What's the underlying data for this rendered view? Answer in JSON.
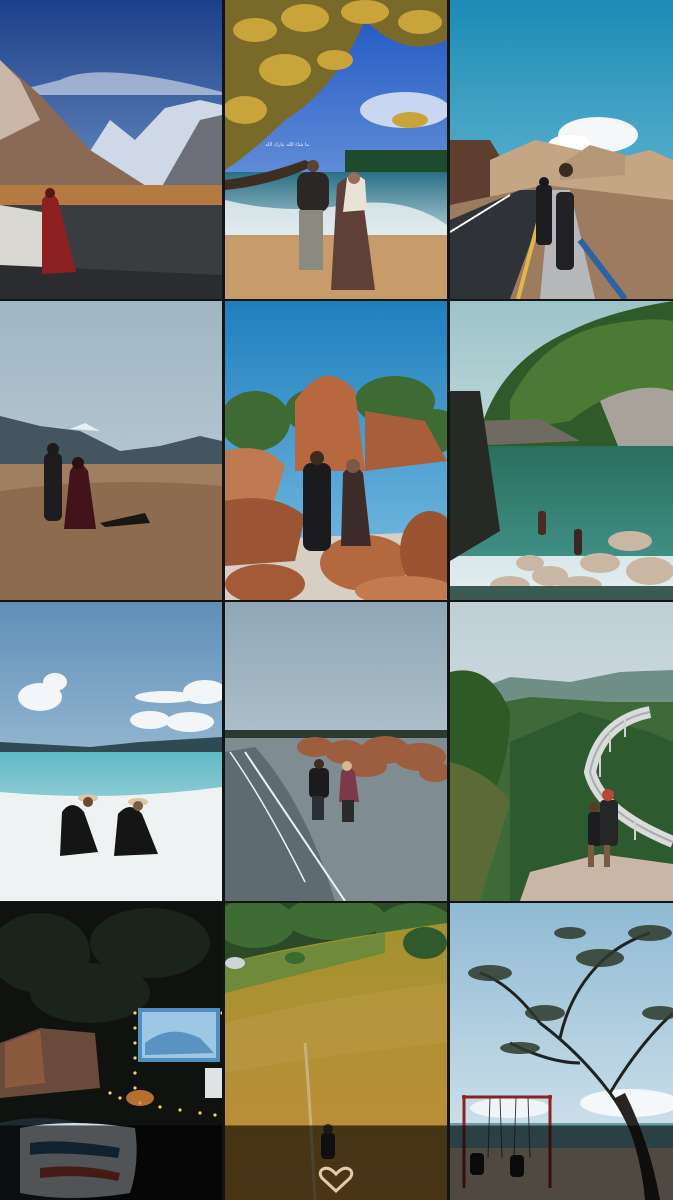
{
  "feed": {
    "columns": 3,
    "rows": 4,
    "tiles": [
      {
        "id": "tile-1",
        "scene": "snowy mountains, river bank, woman in red"
      },
      {
        "id": "tile-2",
        "scene": "couple walking on beach under tree",
        "caption": "ما شاء الله تبارك الله"
      },
      {
        "id": "tile-3",
        "scene": "couple on mountain road"
      },
      {
        "id": "tile-4",
        "scene": "couple walking on desert sand dunes"
      },
      {
        "id": "tile-5",
        "scene": "couple among red boulders"
      },
      {
        "id": "tile-6",
        "scene": "turquoise cove under cliffs"
      },
      {
        "id": "tile-7",
        "scene": "couple sitting in shallow white-sand sea"
      },
      {
        "id": "tile-8",
        "scene": "couple wading toward rocky shore"
      },
      {
        "id": "tile-9",
        "scene": "couple overlooking curved highway bridge"
      },
      {
        "id": "tile-10",
        "scene": "night camping with projector screen and string lights"
      },
      {
        "id": "tile-11",
        "scene": "path through golden grass hillside"
      },
      {
        "id": "tile-12",
        "scene": "tree silhouette and swing set on beach"
      }
    ]
  },
  "colors": {
    "background": "#141414",
    "overlay": "rgba(0,0,0,0.42)"
  }
}
